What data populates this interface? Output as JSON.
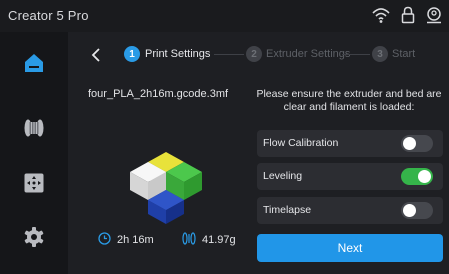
{
  "status_bar": {
    "title": "Creator 5 Pro",
    "icons": [
      "wifi-icon",
      "lock-icon",
      "user-icon"
    ]
  },
  "sidebar": {
    "items": [
      {
        "name": "home",
        "icon": "home-icon",
        "active": true
      },
      {
        "name": "filament",
        "icon": "filament-spool-icon",
        "active": false
      },
      {
        "name": "control",
        "icon": "move-control-icon",
        "active": false
      },
      {
        "name": "settings",
        "icon": "gear-icon",
        "active": false
      }
    ]
  },
  "stepper": {
    "steps": [
      {
        "num": "1",
        "label": "Print Settings",
        "active": true
      },
      {
        "num": "2",
        "label": "Extruder Settings",
        "active": false
      },
      {
        "num": "3",
        "label": "Start",
        "active": false
      }
    ]
  },
  "file": {
    "name": "four_PLA_2h16m.gcode.3mf",
    "time": "2h 16m",
    "weight": "41.97g"
  },
  "notice": "Please ensure the extruder and bed are clear and filament is loaded:",
  "toggles": [
    {
      "label": "Flow Calibration",
      "on": false
    },
    {
      "label": "Leveling",
      "on": true
    },
    {
      "label": "Timelapse",
      "on": false
    }
  ],
  "next_label": "Next",
  "colors": {
    "accent": "#2196e8",
    "toggle_on": "#35b44a",
    "sidebar_active": "#2a9be6",
    "cube_yellow": "#e8e23a",
    "cube_white": "#e8e8e8",
    "cube_green": "#3aa83a",
    "cube_blue": "#1f3fa8"
  }
}
